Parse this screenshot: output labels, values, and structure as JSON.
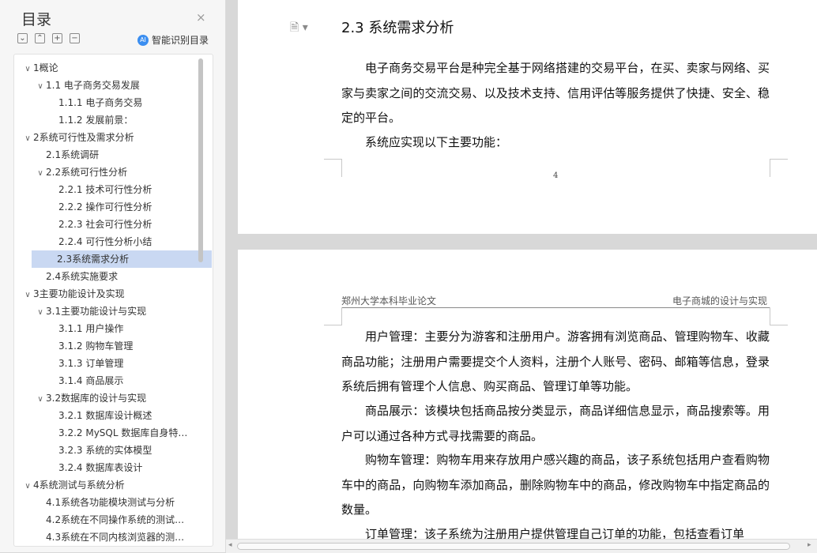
{
  "sidebar": {
    "title": "目录",
    "close": "×",
    "tools": [
      "⌄",
      "⌃",
      "+",
      "−"
    ],
    "smart_toc": "智能识别目录",
    "smart_icon_text": "AI"
  },
  "toc": [
    {
      "label": "1概论",
      "level": 0,
      "chevron": "∨"
    },
    {
      "label": "1.1 电子商务交易发展",
      "level": 1,
      "chevron": "∨"
    },
    {
      "label": "1.1.1 电子商务交易",
      "level": 2
    },
    {
      "label": "1.1.2 发展前景：",
      "level": 2
    },
    {
      "label": "2系统可行性及需求分析",
      "level": 0,
      "chevron": "∨"
    },
    {
      "label": "2.1系统调研",
      "level": 1
    },
    {
      "label": "2.2系统可行性分析",
      "level": 1,
      "chevron": "∨"
    },
    {
      "label": "2.2.1 技术可行性分析",
      "level": 2
    },
    {
      "label": "2.2.2  操作可行性分析",
      "level": 2
    },
    {
      "label": "2.2.3  社会可行性分析",
      "level": 2
    },
    {
      "label": "2.2.4 可行性分析小结",
      "level": 2
    },
    {
      "label": "2.3系统需求分析",
      "level": 1,
      "selected": true
    },
    {
      "label": "2.4系统实施要求",
      "level": 1
    },
    {
      "label": "3主要功能设计及实现",
      "level": 0,
      "chevron": "∨"
    },
    {
      "label": "3.1主要功能设计与实现",
      "level": 1,
      "chevron": "∨"
    },
    {
      "label": "3.1.1  用户操作",
      "level": 2
    },
    {
      "label": "3.1.2 购物车管理",
      "level": 2
    },
    {
      "label": "3.1.3 订单管理",
      "level": 2
    },
    {
      "label": "3.1.4 商品展示",
      "level": 2
    },
    {
      "label": "3.2数据库的设计与实现",
      "level": 1,
      "chevron": "∨"
    },
    {
      "label": "3.2.1 数据库设计概述",
      "level": 2
    },
    {
      "label": "3.2.2 MySQL 数据库自身特…",
      "level": 2
    },
    {
      "label": "3.2.3  系统的实体模型",
      "level": 2
    },
    {
      "label": "3.2.4 数据库表设计",
      "level": 2
    },
    {
      "label": "4系统测试与系统分析",
      "level": 0,
      "chevron": "∨"
    },
    {
      "label": "4.1系统各功能模块测试与分析",
      "level": 1
    },
    {
      "label": "4.2系统在不同操作系统的测试…",
      "level": 1
    },
    {
      "label": "4.3系统在不同内核浏览器的测…",
      "level": 1
    }
  ],
  "page1": {
    "heading": "2.3  系统需求分析",
    "p1": "电子商务交易平台是种完全基于网络搭建的交易平台，在买、卖家与网络、买家与卖家之间的交流交易、以及技术支持、信用评估等服务提供了快捷、安全、稳定的平台。",
    "p2": "系统应实现以下主要功能：",
    "page_number": "4",
    "doc_icon": "🗎 ▾"
  },
  "page2": {
    "header_left": "郑州大学本科毕业论文",
    "header_right": "电子商城的设计与实现",
    "p1": "用户管理：主要分为游客和注册用户。游客拥有浏览商品、管理购物车、收藏商品功能；注册用户需要提交个人资料，注册个人账号、密码、邮箱等信息，登录系统后拥有管理个人信息、购买商品、管理订单等功能。",
    "p2": "商品展示：该模块包括商品按分类显示，商品详细信息显示，商品搜索等。用户可以通过各种方式寻找需要的商品。",
    "p3": "购物车管理：购物车用来存放用户感兴趣的商品，该子系统包括用户查看购物车中的商品，向购物车添加商品，删除购物车中的商品，修改购物车中指定商品的数量。",
    "p4": "订单管理：该子系统为注册用户提供管理自己订单的功能，包括查看订单"
  },
  "hscroll": {
    "left": "◂",
    "right": "▸"
  }
}
